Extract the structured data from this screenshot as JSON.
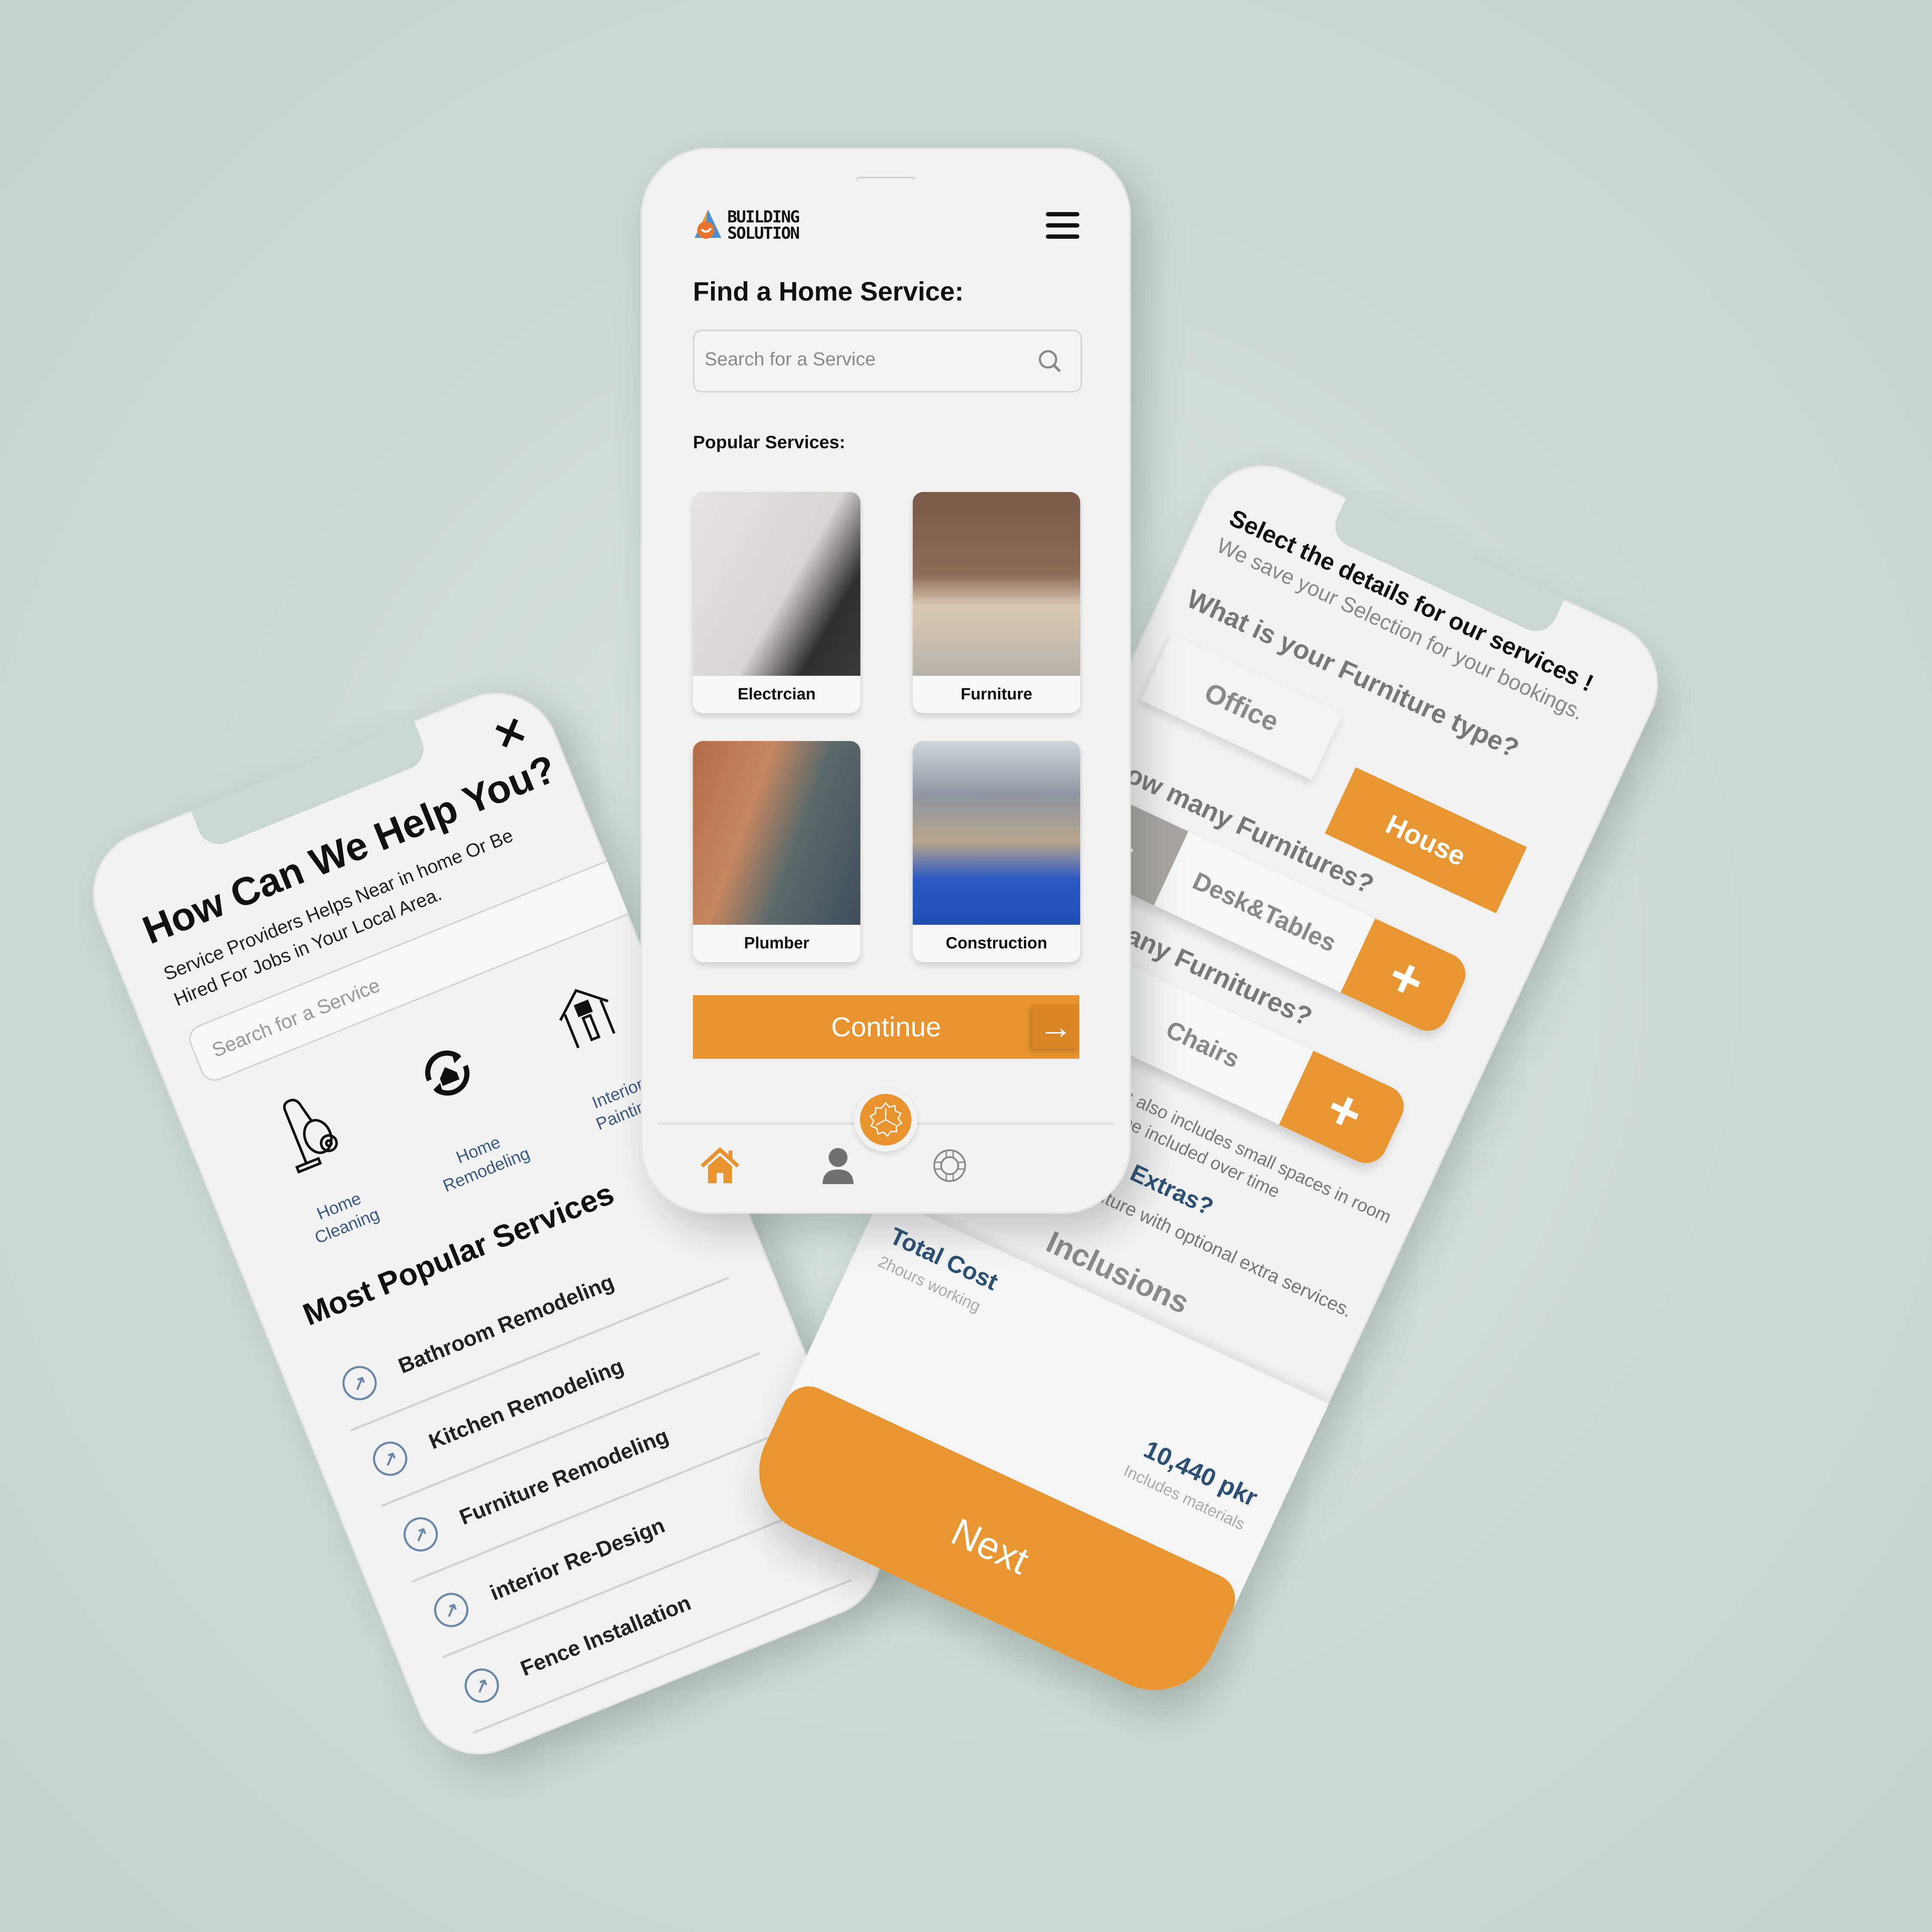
{
  "colors": {
    "accent": "#e8932e",
    "secondary_gray": "#a8a5a1",
    "navy_text": "#2c4f74",
    "link_blue": "#3b5a84",
    "background": "#c9d6d1"
  },
  "center_screen": {
    "brand": {
      "line1": "BUILDING",
      "line2": "SOLUTION",
      "logo_icon": "house-wrench-logo-icon"
    },
    "menu_icon": "hamburger-menu-icon",
    "title": "Find a Home Service:",
    "search": {
      "placeholder": "Search for a Service",
      "value": "",
      "icon": "search-icon"
    },
    "popular_label": "Popular Services:",
    "services": [
      {
        "label": "Electrcian",
        "photo": "electrician-photo"
      },
      {
        "label": "Furniture",
        "photo": "furniture-photo"
      },
      {
        "label": "Plumber",
        "photo": "plumber-photo"
      },
      {
        "label": "Construction",
        "photo": "construction-photo"
      }
    ],
    "continue_label": "Continue",
    "continue_icon": "arrow-right-icon",
    "nav": {
      "center_fab_icon": "gear-icon",
      "items": [
        {
          "name": "home",
          "icon": "home-icon",
          "active": true
        },
        {
          "name": "profile",
          "icon": "user-icon",
          "active": false
        },
        {
          "name": "support",
          "icon": "lifebuoy-icon",
          "active": false
        }
      ]
    }
  },
  "left_screen": {
    "close_icon": "close-icon",
    "title": "How Can We Help You?",
    "subtitle": "Service Providers Helps  Near  in home Or Be Hired For Jobs in Your Local Area.",
    "search": {
      "placeholder": "Search for a Service",
      "value": ""
    },
    "categories": [
      {
        "label_line1": "Home",
        "label_line2": "Cleaning",
        "icon": "vacuum-cleaner-icon",
        "glyph": "🧹"
      },
      {
        "label_line1": "Home",
        "label_line2": "Remodeling",
        "icon": "home-refresh-icon",
        "glyph": "⟳"
      },
      {
        "label_line1": "Interior",
        "label_line2": "Painting",
        "icon": "paint-roller-house-icon",
        "glyph": "⌂"
      }
    ],
    "most_popular_title": "Most Popular Services",
    "most_popular": [
      "Bathroom Remodeling",
      "Kitchen Remodeling",
      "Furniture Remodeling",
      "interior Re-Design",
      "Fence Installation"
    ]
  },
  "right_screen": {
    "heading": "Select the details for our services !",
    "subheading": "We save your Selection for your bookings.",
    "furniture_type_question": "What is your Furniture type?",
    "furniture_types": [
      {
        "label": "Office",
        "selected": false
      },
      {
        "label": "House",
        "selected": true
      }
    ],
    "steppers": [
      {
        "question": "How many Furnitures?",
        "item": "Desk&Tables",
        "minus": "−",
        "plus": "+"
      },
      {
        "question": "How many Furnitures?",
        "item": "Chairs",
        "minus": "−",
        "plus": "+"
      }
    ],
    "notes": [
      "* Furniturer services also includes small spaces in room",
      "+ Extra charges will be included over time"
    ],
    "extras_title": "Want Something Extras?",
    "extras_subtitle": "Customizing your furniture with optional extra services.",
    "inclusions_label": "Inclusions",
    "total_cost_label": "Total Cost",
    "hours_label": "2hours working",
    "price": "10,440 pkr",
    "price_note": "Includes materials",
    "next_label": "Next"
  }
}
